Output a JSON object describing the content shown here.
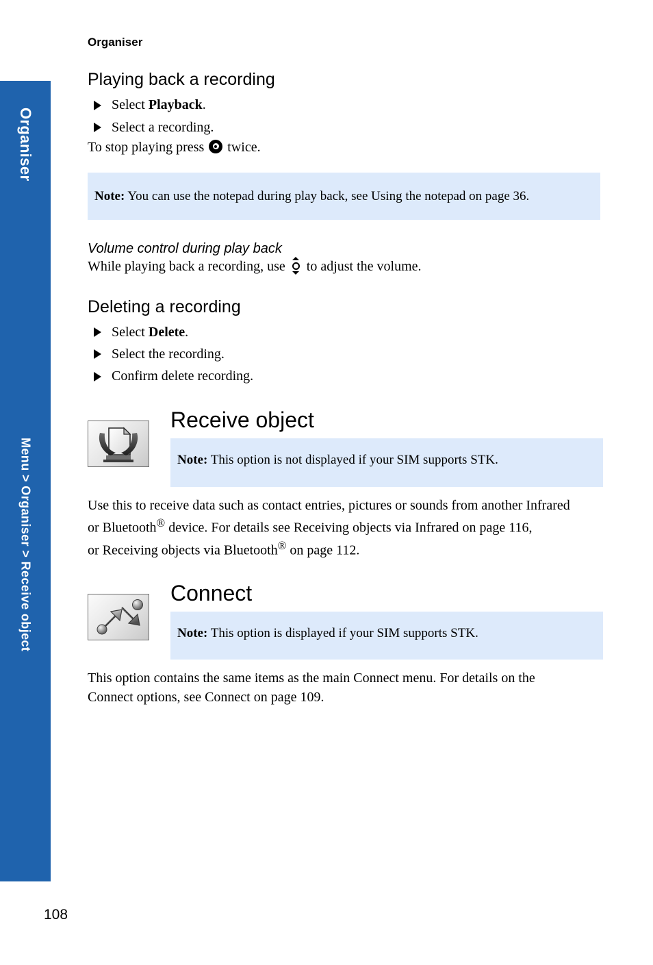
{
  "page": {
    "number": "108",
    "running_head": "Organiser",
    "accent_color": "#1f63ad",
    "note_background": "#ddeafb"
  },
  "side_tabs": {
    "chapter": "Organiser",
    "breadcrumb": "Menu > Organiser > Receive object"
  },
  "sections": {
    "playback": {
      "heading": "Playing back a recording",
      "steps": [
        {
          "prefix": "Select ",
          "bold": "Playback",
          "suffix": "."
        },
        {
          "prefix": "Select a recording.",
          "bold": "",
          "suffix": ""
        }
      ],
      "stop_text_before": "To stop playing press",
      "stop_text_after": "twice.",
      "stop_key_icon": "select-key-icon",
      "note": {
        "label": "Note:",
        "text": "You can use the notepad during play back, see Using the notepad on page 36."
      }
    },
    "volume": {
      "heading": "Volume control during play back",
      "text_before": "While playing back a recording, use",
      "text_after": "to adjust the volume.",
      "key_icon": "up-down-key-icon"
    },
    "deleting": {
      "heading": "Deleting a recording",
      "steps": [
        {
          "prefix": "Select ",
          "bold": "Delete",
          "suffix": "."
        },
        {
          "prefix": "Select the recording.",
          "bold": "",
          "suffix": ""
        },
        {
          "prefix": "Confirm delete recording.",
          "bold": "",
          "suffix": ""
        }
      ]
    },
    "receive_object": {
      "title": "Receive object",
      "icon": "receive-object-icon",
      "note": {
        "label": "Note:",
        "text": "This option is not displayed if your SIM supports STK."
      },
      "body_line1": "Use this to receive data such as contact entries, pictures or sounds from another Infrared",
      "body_line2_a": "or Bluetooth",
      "body_line2_sup": "®",
      "body_line2_b": " device. For details see Receiving objects via Infrared on page 116,",
      "body_line3_a": "or Receiving objects via Bluetooth",
      "body_line3_sup": "®",
      "body_line3_b": " on page 112."
    },
    "connect": {
      "title": "Connect",
      "icon": "connect-icon",
      "note": {
        "label": "Note:",
        "text": "This option is displayed if your SIM supports STK."
      },
      "body_line1": "This option contains the same items as the main Connect menu. For details on the",
      "body_line2": "Connect options, see Connect on page 109."
    }
  }
}
